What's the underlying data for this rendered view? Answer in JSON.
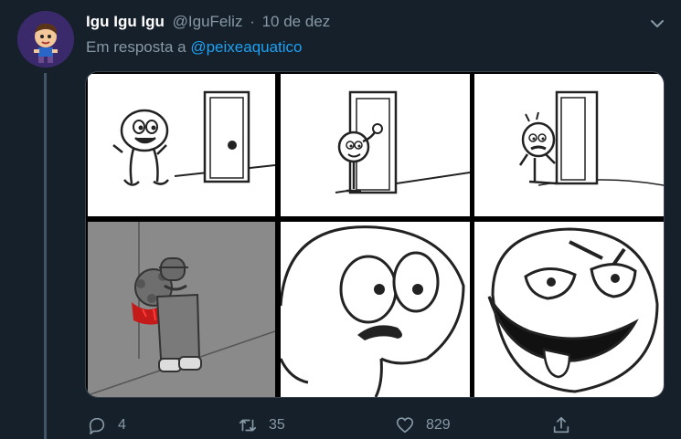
{
  "tweet": {
    "display_name": "Igu Igu Igu",
    "handle": "@IguFeliz",
    "separator": "·",
    "date": "10 de dez",
    "reply_prefix": "Em resposta a",
    "reply_to": "@peixeaquatico"
  },
  "actions": {
    "replies": "4",
    "retweets": "35",
    "likes": "829"
  },
  "colors": {
    "background": "#15202b",
    "secondary_text": "#8899a6",
    "link": "#1da1f2"
  },
  "icons": [
    "chevron-down-icon",
    "reply-icon",
    "retweet-icon",
    "like-icon",
    "share-icon"
  ]
}
